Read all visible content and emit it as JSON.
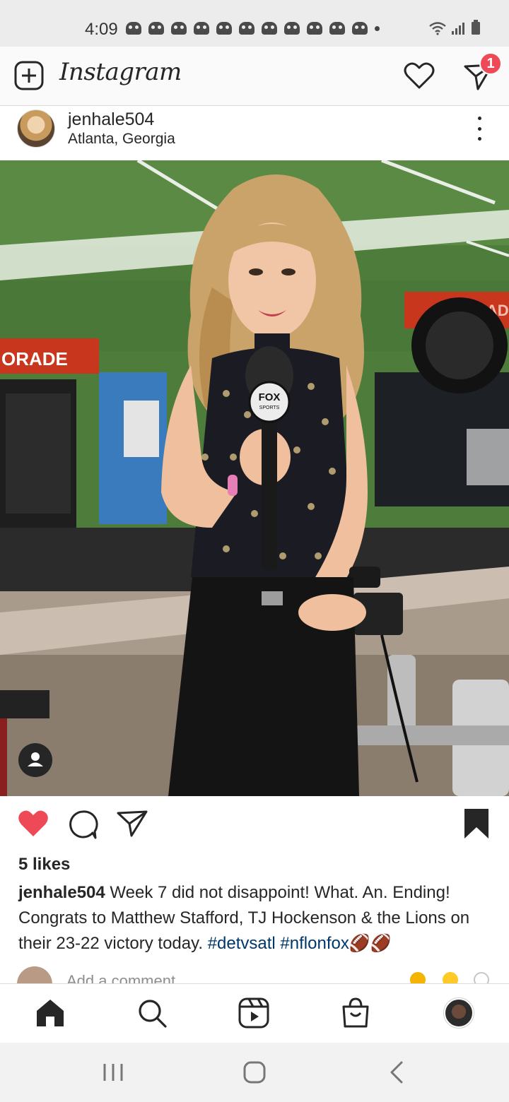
{
  "status_bar": {
    "time": "4:09",
    "notification_icons": [
      "app-notification-icon",
      "app-notification-icon",
      "app-notification-icon",
      "app-notification-icon",
      "app-notification-icon",
      "app-notification-icon",
      "app-notification-icon",
      "app-notification-icon",
      "app-notification-icon",
      "app-notification-icon",
      "app-notification-icon"
    ],
    "system_icons": [
      "wifi-icon",
      "signal-icon",
      "battery-icon"
    ]
  },
  "header": {
    "app_name": "Instagram",
    "new_post_icon": "plus-square-icon",
    "activity_icon": "heart-outline-icon",
    "direct_icon": "paper-plane-icon",
    "direct_badge_count": "1",
    "accent_color": "#ed4956"
  },
  "post": {
    "username": "jenhale504",
    "location": "Atlanta, Georgia",
    "menu_icon": "more-vertical-icon",
    "image_alt": "Sportscaster holding a FOX Sports microphone at a stadium",
    "mic_flag": "FOX",
    "mic_flag_sub": "SPORTS",
    "signage_left": "ORADE",
    "signage_right": "RAD",
    "liked": true,
    "saved": true,
    "likes": "5 likes",
    "caption": {
      "user": "jenhale504",
      "text": " Week 7 did not disappoint! What. An. Ending! Congrats to  Matthew Stafford, TJ Hockenson & the Lions on their 23-22 victory today. ",
      "hashtags": [
        "#detvsatl",
        "#nflonfox"
      ],
      "emoji": "🏈🏈"
    },
    "comment_placeholder": "Add a comment..."
  },
  "tab_bar": {
    "items": [
      "home-icon",
      "search-icon",
      "reels-icon",
      "shop-icon",
      "profile-avatar"
    ]
  },
  "nav_bar": {
    "items": [
      "recent-apps-icon",
      "home-button-icon",
      "back-icon"
    ]
  }
}
